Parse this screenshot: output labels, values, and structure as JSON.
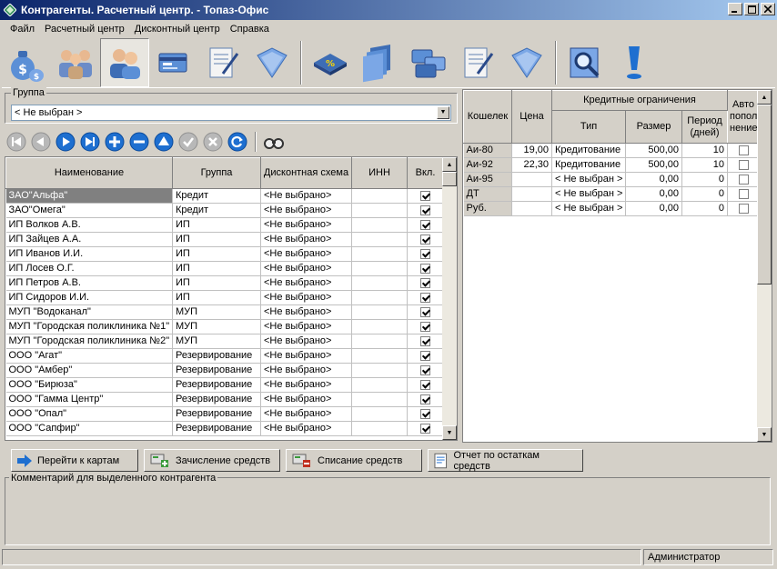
{
  "window": {
    "title": "Контрагенты. Расчетный центр. - Топаз-Офис"
  },
  "menu": [
    "Файл",
    "Расчетный центр",
    "Дисконтный центр",
    "Справка"
  ],
  "toolbar": [
    {
      "icon": "money-bag-icon"
    },
    {
      "icon": "users-group-icon"
    },
    {
      "icon": "contractors-icon",
      "active": true
    },
    {
      "icon": "cards-icon"
    },
    {
      "icon": "document-edit-icon"
    },
    {
      "icon": "folder-icon"
    },
    {
      "icon": "discount-book-icon"
    },
    {
      "icon": "card-stack-icon"
    },
    {
      "icon": "cards-multi-icon"
    },
    {
      "icon": "document-pen-icon"
    },
    {
      "icon": "folder-blue-icon"
    },
    {
      "icon": "magnifier-icon"
    },
    {
      "icon": "exclamation-icon"
    }
  ],
  "group": {
    "label": "Группа",
    "value": "< Не выбран >"
  },
  "navigation": [
    "first-record-icon",
    "prev-record-icon",
    "next-record-icon",
    "last-record-icon",
    "add-record-icon",
    "delete-record-icon",
    "edit-record-icon",
    "post-record-icon",
    "cancel-record-icon",
    "refresh-icon",
    "find-icon"
  ],
  "contractors": {
    "columns": [
      "Наименование",
      "Группа",
      "Дисконтная схема",
      "ИНН",
      "Вкл."
    ],
    "rows": [
      [
        "ЗАО\"Альфа\"",
        "Кредит",
        "<Не выбрано>",
        "",
        true
      ],
      [
        "ЗАО\"Омега\"",
        "Кредит",
        "<Не выбрано>",
        "",
        true
      ],
      [
        "ИП Волков А.В.",
        "ИП",
        "<Не выбрано>",
        "",
        true
      ],
      [
        "ИП Зайцев А.А.",
        "ИП",
        "<Не выбрано>",
        "",
        true
      ],
      [
        "ИП Иванов И.И.",
        "ИП",
        "<Не выбрано>",
        "",
        true
      ],
      [
        "ИП Лосев О.Г.",
        "ИП",
        "<Не выбрано>",
        "",
        true
      ],
      [
        "ИП Петров А.В.",
        "ИП",
        "<Не выбрано>",
        "",
        true
      ],
      [
        "ИП Сидоров И.И.",
        "ИП",
        "<Не выбрано>",
        "",
        true
      ],
      [
        "МУП \"Водоканал\"",
        "МУП",
        "<Не выбрано>",
        "",
        true
      ],
      [
        "МУП \"Городская поликлиника №1\"",
        "МУП",
        "<Не выбрано>",
        "",
        true
      ],
      [
        "МУП \"Городская поликлиника №2\"",
        "МУП",
        "<Не выбрано>",
        "",
        true
      ],
      [
        "ООО \"Агат\"",
        "Резервирование",
        "<Не выбрано>",
        "",
        true
      ],
      [
        "ООО \"Амбер\"",
        "Резервирование",
        "<Не выбрано>",
        "",
        true
      ],
      [
        "ООО \"Бирюза\"",
        "Резервирование",
        "<Не выбрано>",
        "",
        true
      ],
      [
        "ООО \"Гамма Центр\"",
        "Резервирование",
        "<Не выбрано>",
        "",
        true
      ],
      [
        "ООО \"Опал\"",
        "Резервирование",
        "<Не выбрано>",
        "",
        true
      ],
      [
        "ООО \"Сапфир\"",
        "Резервирование",
        "<Не выбрано>",
        "",
        true
      ]
    ]
  },
  "wallets": {
    "header": {
      "wallet": "Кошелек",
      "price": "Цена",
      "credit_limits": "Кредитные ограничения",
      "type": "Тип",
      "size": "Размер",
      "period": "Период (дней)",
      "auto": "Авто попол нение"
    },
    "rows": [
      [
        "Аи-80",
        "19,00",
        "Кредитование",
        "500,00",
        "10",
        false
      ],
      [
        "Аи-92",
        "22,30",
        "Кредитование",
        "500,00",
        "10",
        false
      ],
      [
        "Аи-95",
        "",
        "< Не выбран >",
        "0,00",
        "0",
        false
      ],
      [
        "ДТ",
        "",
        "< Не выбран >",
        "0,00",
        "0",
        false
      ],
      [
        "Руб.",
        "",
        "< Не выбран >",
        "0,00",
        "0",
        false
      ]
    ]
  },
  "actions": {
    "go_to_cards": "Перейти к картам",
    "credit_funds": "Зачисление средств",
    "debit_funds": "Списание средств",
    "balance_report": "Отчет по остаткам средств"
  },
  "comment": {
    "label": "Комментарий для выделенного контрагента"
  },
  "status": {
    "user": "Администратор"
  }
}
